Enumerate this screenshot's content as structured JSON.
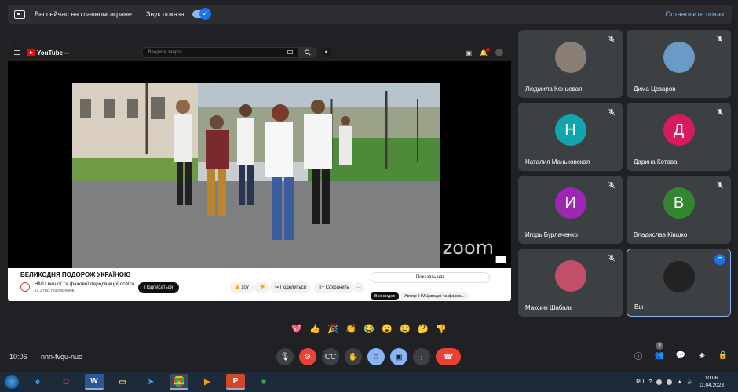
{
  "share_bar": {
    "status_text": "Вы сейчас на главном экране",
    "sound_label": "Звук показа",
    "sound_toggle_state": "on",
    "stop_label": "Остановить показ"
  },
  "youtube": {
    "logo_text": "YouTube",
    "logo_region": "UA",
    "search_placeholder": "Введите запрос",
    "notification_badge": "9+",
    "video_title": "ВЕЛИКОДНЯ ПОДОРОЖ УКРАЇНОЮ",
    "channel_name": "НМЦ вищої та фахової передвищої освіти",
    "channel_subs": "11,1 тис. подписчиков",
    "subscribe_label": "Подписаться",
    "likes": "107",
    "share_label": "Поделиться",
    "save_label": "Сохранить",
    "more_label": "···",
    "chat_label": "Показать чат",
    "chip_all": "Все видео",
    "chip_author": "Автор: НМЦ вищої та фахов...",
    "watermark": "zoom"
  },
  "participants": [
    {
      "name": "Людмила Концевая",
      "initial": "",
      "color": "#8a7f74",
      "photo": true
    },
    {
      "name": "Дима Цезаров",
      "initial": "",
      "color": "#6a9bc6",
      "photo": true
    },
    {
      "name": "Наталия Маньковская",
      "initial": "Н",
      "color": "#12a4af",
      "photo": false
    },
    {
      "name": "Дарина Котова",
      "initial": "Д",
      "color": "#d81b60",
      "photo": false
    },
    {
      "name": "Игорь Бурлаченко",
      "initial": "И",
      "color": "#9c27b0",
      "photo": false
    },
    {
      "name": "Владислав Кiвшко",
      "initial": "В",
      "color": "#33862f",
      "photo": false
    },
    {
      "name": "Максим Шабаль",
      "initial": "",
      "color": "#c0506a",
      "photo": true
    },
    {
      "name": "Вы",
      "initial": "",
      "color": "#222222",
      "photo": true
    }
  ],
  "reactions": [
    "💖",
    "👍",
    "🎉",
    "👏",
    "😂",
    "😮",
    "😢",
    "🤔",
    "👎"
  ],
  "meeting": {
    "time": "10:06",
    "code": "nnn-fvqu-nuo",
    "people_count": "9"
  },
  "taskbar": {
    "apps": [
      "ie-icon",
      "opera-icon",
      "word-icon",
      "explorer-icon",
      "telegram-icon",
      "chrome-icon",
      "media-icon",
      "powerpoint-icon",
      "meet-icon"
    ],
    "lang": "RU",
    "clock_time": "10:06",
    "clock_date": "11.04.2023"
  }
}
